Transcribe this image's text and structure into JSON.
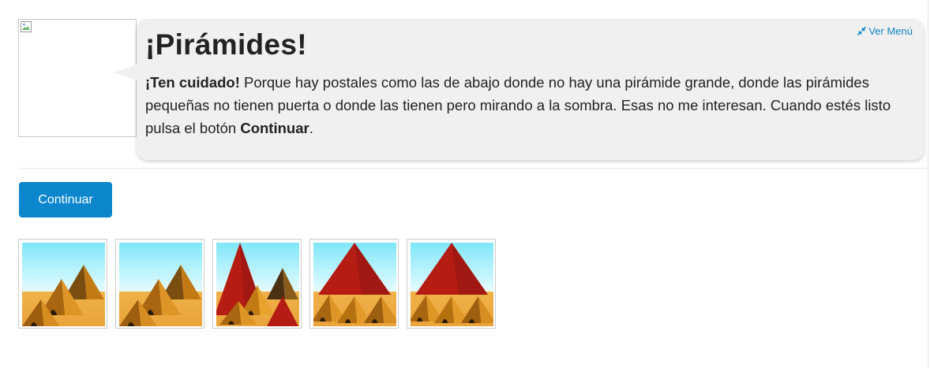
{
  "bubble": {
    "title": "¡Pirámides!",
    "menu_link_label": "Ver Menú",
    "text": {
      "warning": "¡Ten cuidado!",
      "body": " Porque hay postales como las de abajo donde no hay una pirámide grande, donde las pirámides pequeñas no tienen puerta o donde las tienen pero mirando a la sombra. Esas no me interesan. Cuando estés listo pulsa el botón ",
      "button_ref": "Continuar",
      "end": "."
    }
  },
  "actions": {
    "continue_label": "Continuar"
  },
  "postcards": [
    {
      "big_pyramid": false,
      "small_pyramids": 3
    },
    {
      "big_pyramid": false,
      "small_pyramids": 3
    },
    {
      "big_pyramid": true,
      "small_pyramids": 3,
      "extra_red_pyramid": true
    },
    {
      "big_pyramid": true,
      "small_pyramids": 3
    },
    {
      "big_pyramid": true,
      "small_pyramids": 3
    }
  ],
  "colors": {
    "accent": "#0c86cc",
    "link": "#0e86c8",
    "bubble_bg": "#f0f0f0",
    "sky_top": "#7fe7f9",
    "sand": "#e9a33a",
    "big_pyramid": "#b51c14",
    "small_pyramid": "#d98a1a"
  },
  "icons": {
    "menu_link": "compress-arrows-icon",
    "avatar": "broken-image-icon"
  }
}
